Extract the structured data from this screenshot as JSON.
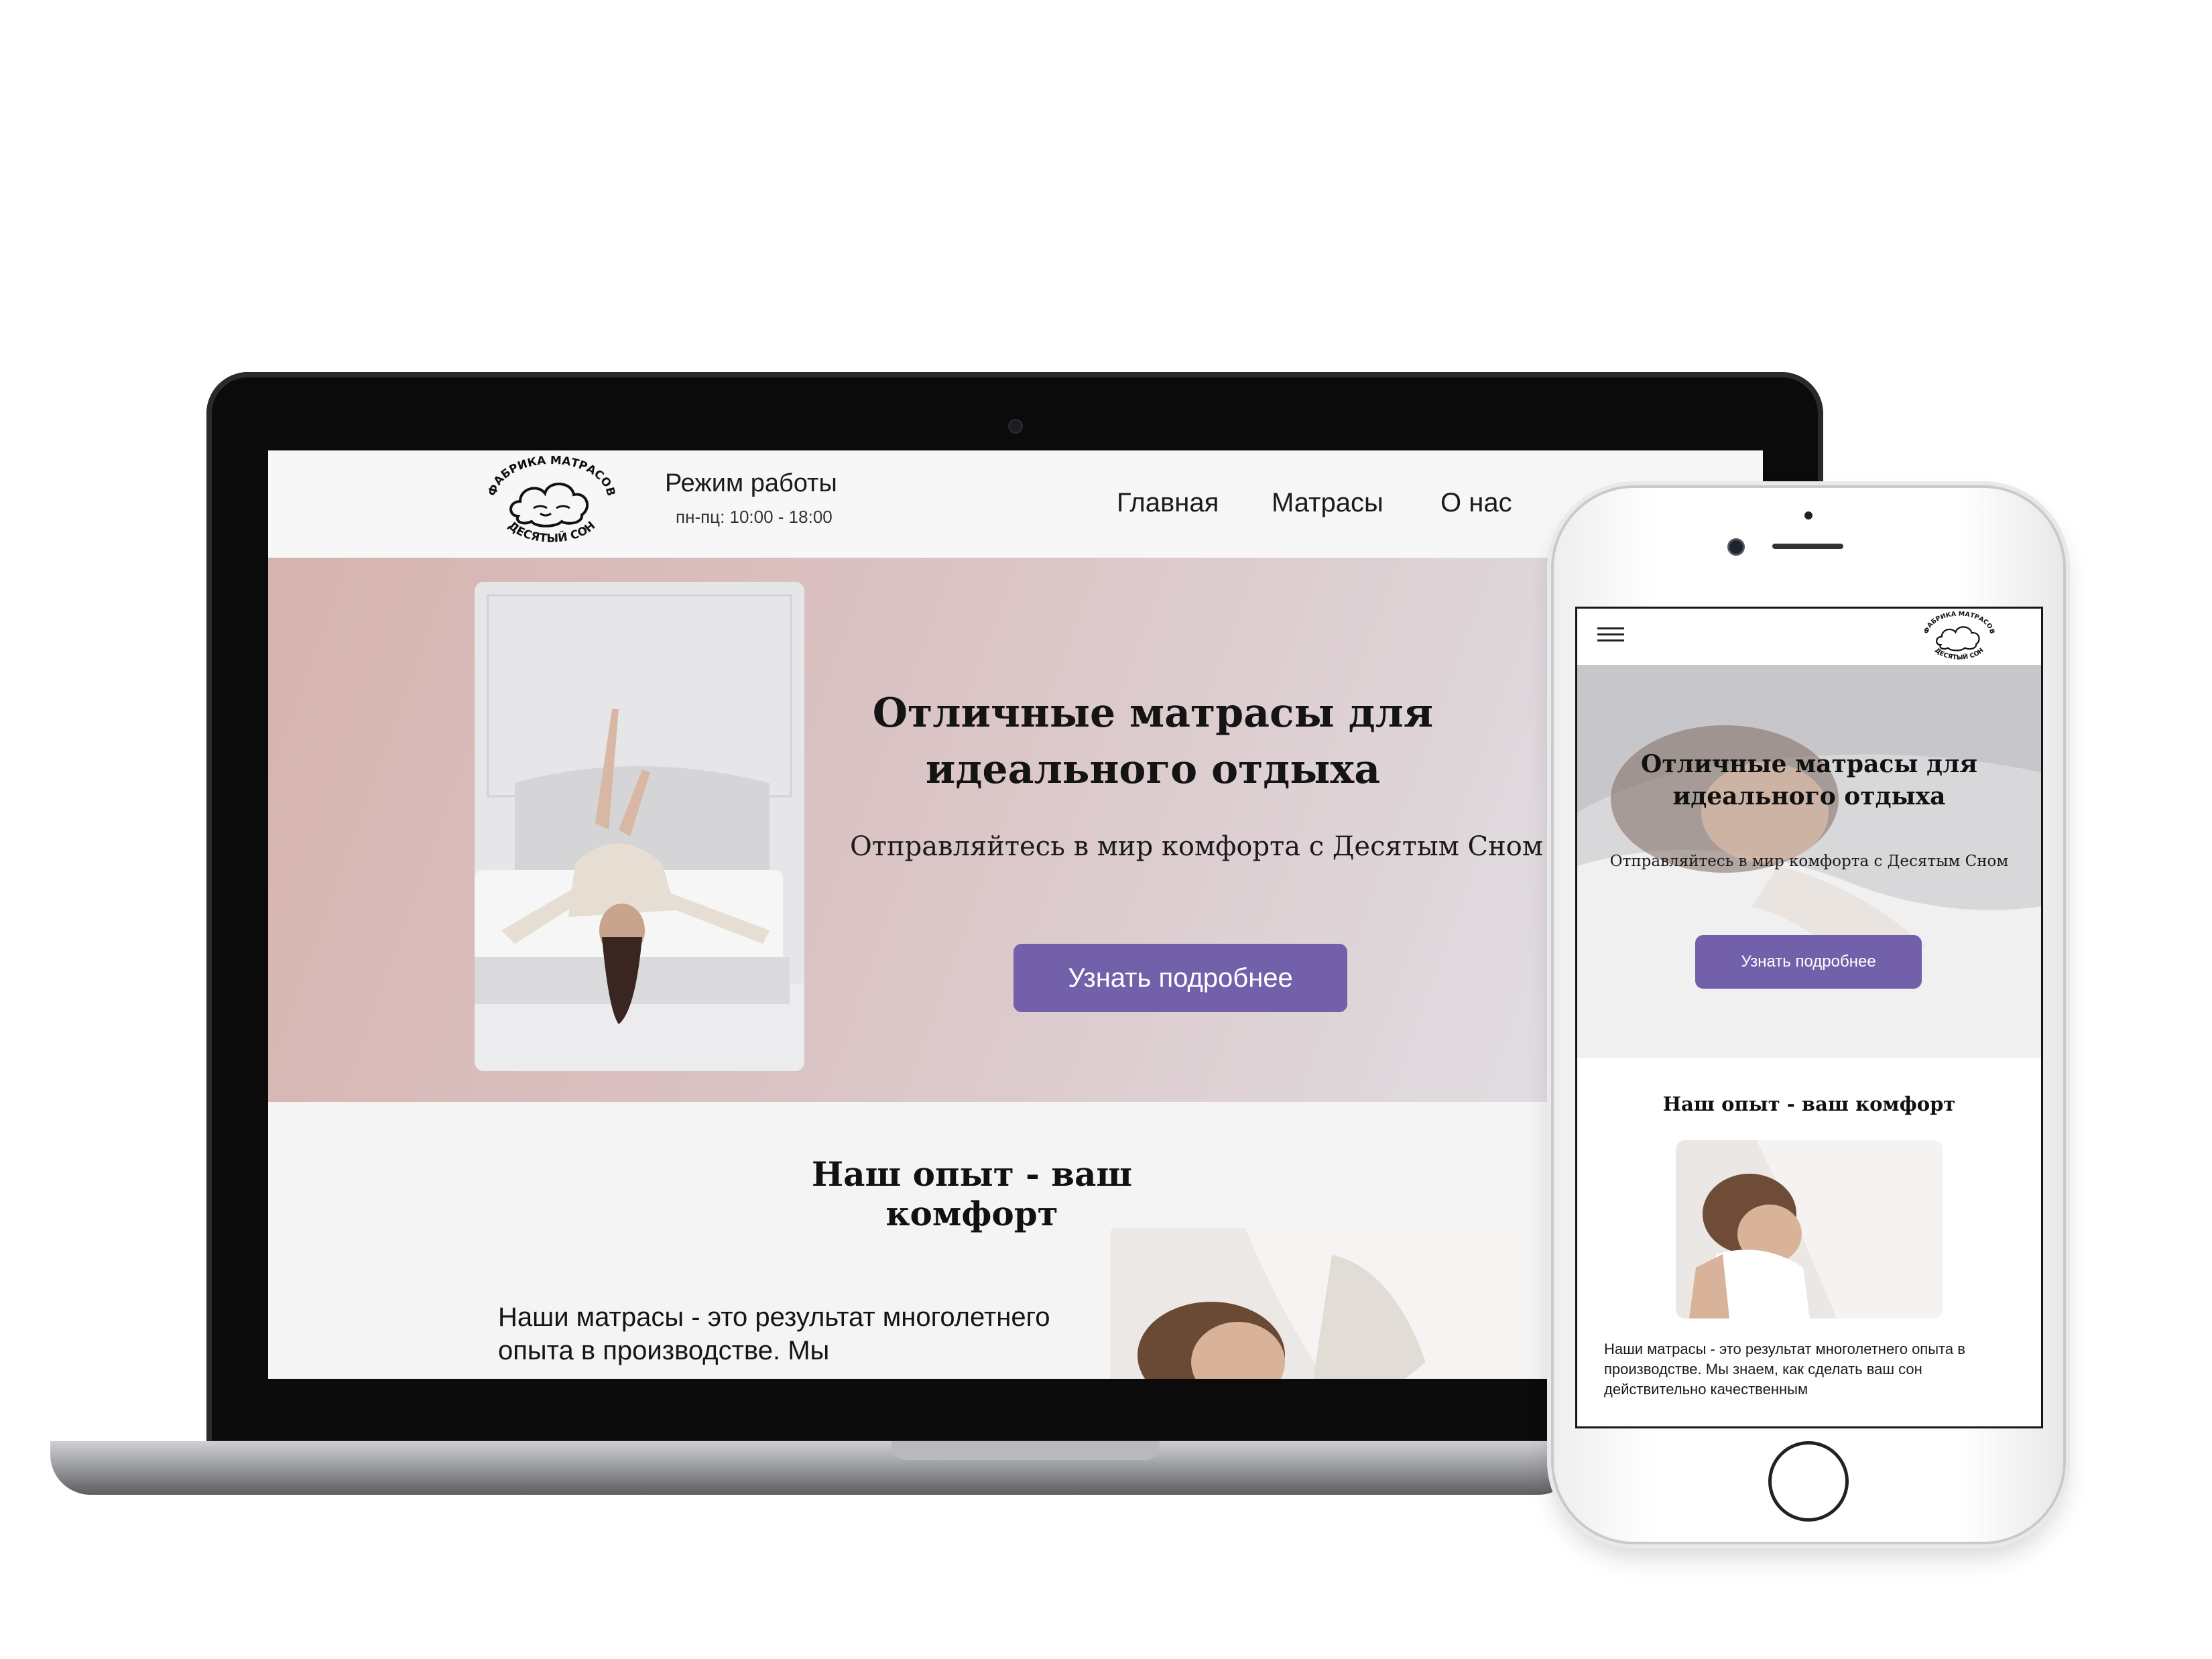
{
  "brand": {
    "logo_alt": "Фабрика матрасов Десятый сон",
    "logo_top_text": "ФАБРИКА МАТРАСОВ",
    "logo_bottom_text": "ДЕСЯТЫЙ СОН"
  },
  "desktop": {
    "header": {
      "hours_label": "Режим работы",
      "hours_value": "пн-пц: 10:00 - 18:00",
      "nav": [
        "Главная",
        "Матрасы",
        "О нас"
      ]
    },
    "hero": {
      "title": "Отличные матрасы для идеального отдыха",
      "subtitle": "Отправляйтесь в мир комфорта с Десятым Сном",
      "button": "Узнать подробнее"
    },
    "section": {
      "title": "Наш опыт - ваш комфорт",
      "text": "Наши матрасы - это результат многолетнего опыта в производстве. Мы"
    }
  },
  "mobile": {
    "hero": {
      "title": "Отличные матрасы для идеального отдыха",
      "subtitle": "Отправляйтесь в мир комфорта с Десятым Сном",
      "button": "Узнать подробнее"
    },
    "section": {
      "title": "Наш опыт - ваш комфорт",
      "text": "Наши матрасы - это результат многолетнего опыта в производстве. Мы знаем, как сделать ваш сон действительно качественным"
    }
  },
  "colors": {
    "accent": "#7360ab",
    "hero_gradient_start": "#d6b3af",
    "hero_gradient_end": "#e2e4ea",
    "laptop_bezel": "#0b0b0c"
  }
}
